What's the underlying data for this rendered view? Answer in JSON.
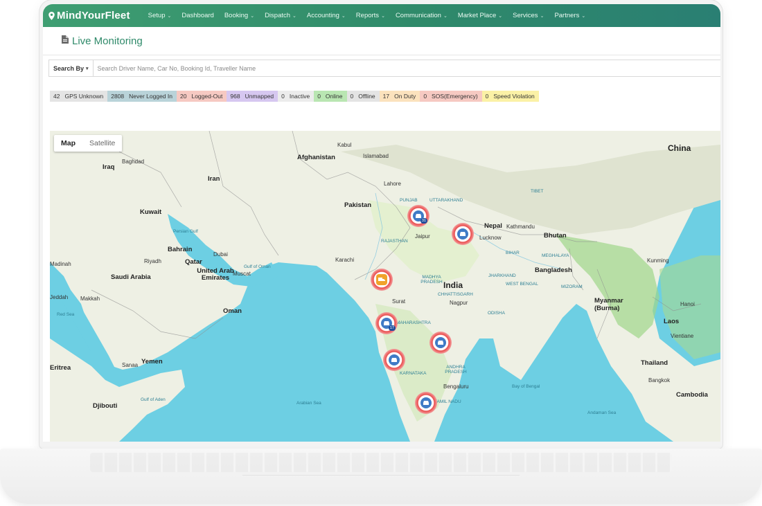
{
  "brand": {
    "name": "MindYourFleet"
  },
  "nav": [
    {
      "label": "Setup",
      "has_caret": true
    },
    {
      "label": "Dashboard",
      "has_caret": false
    },
    {
      "label": "Booking",
      "has_caret": true
    },
    {
      "label": "Dispatch",
      "has_caret": true
    },
    {
      "label": "Accounting",
      "has_caret": true
    },
    {
      "label": "Reports",
      "has_caret": true
    },
    {
      "label": "Communication",
      "has_caret": true
    },
    {
      "label": "Market Place",
      "has_caret": true
    },
    {
      "label": "Services",
      "has_caret": true
    },
    {
      "label": "Partners",
      "has_caret": true
    }
  ],
  "page": {
    "title": "Live Monitoring"
  },
  "search": {
    "by_label": "Search By",
    "placeholder": "Search Driver Name, Car No, Booking Id, Traveller Name"
  },
  "statuses": [
    {
      "count": "42",
      "label": "GPS Unknown",
      "color": "#e4e4e4"
    },
    {
      "count": "2808",
      "label": "Never Logged In",
      "color": "#b9d3d9"
    },
    {
      "count": "20",
      "label": "Logged-Out",
      "color": "#f6c9c2"
    },
    {
      "count": "968",
      "label": "Unmapped",
      "color": "#d6c7f0"
    },
    {
      "count": "0",
      "label": "Inactive",
      "color": "#ececec"
    },
    {
      "count": "0",
      "label": "Online",
      "color": "#b9e6b2"
    },
    {
      "count": "0",
      "label": "Offline",
      "color": "#e4e4e4"
    },
    {
      "count": "17",
      "label": "On Duty",
      "color": "#fbe2bd"
    },
    {
      "count": "0",
      "label": "SOS(Emergency)",
      "color": "#f6c9c2"
    },
    {
      "count": "0",
      "label": "Speed Violation",
      "color": "#fbf1a6"
    }
  ],
  "map": {
    "toggle": {
      "map": "Map",
      "satellite": "Satellite"
    },
    "labels": {
      "china": "China",
      "afghanistan": "Afghanistan",
      "iran": "Iran",
      "iraq": "Iraq",
      "baghdad": "Baghdad",
      "kuwait": "Kuwait",
      "bahrain": "Bahrain",
      "qatar": "Qatar",
      "riyadh": "Riyadh",
      "saudi": "Saudi Arabia",
      "uae": "United Arab Emirates",
      "dubai": "Dubai",
      "muscat": "Muscat",
      "oman": "Oman",
      "pakistan": "Pakistan",
      "lahore": "Lahore",
      "karachi": "Karachi",
      "islamabad": "Islamabad",
      "kabul": "Kabul",
      "nepal": "Nepal",
      "kathmandu": "Kathmandu",
      "bhutan": "Bhutan",
      "bangladesh": "Bangladesh",
      "india": "India",
      "jaipur": "Jaipur",
      "rajasthan": "RAJASTHAN",
      "madhya": "MADHYA PRADESH",
      "surat": "Surat",
      "nagpur": "Nagpur",
      "maharashtra": "MAHARASHTRA",
      "bengaluru": "Bengaluru",
      "karnataka": "KARNATAKA",
      "yemen": "Yemen",
      "sonaa": "Sanaa",
      "djibouti": "Djibouti",
      "eritrea": "Eritrea",
      "myanmar": "Myanmar (Burma)",
      "laos": "Laos",
      "thailand": "Thailand",
      "bangkok": "Bangkok",
      "cambodia": "Cambodia",
      "vientiane": "Vientiane",
      "hanoi": "Hanoi",
      "madinah": "Madinah",
      "jeddah": "Jeddah",
      "makkah": "Makkah",
      "arabian": "Arabian Sea",
      "bengal": "Bay of Bengal",
      "aden": "Gulf of Aden",
      "andaman": "Andaman Sea",
      "tibet": "TIBET",
      "kunming": "Kunming",
      "mizoram": "MIZORAM",
      "meghalaya": "MEGHALAYA",
      "jharkhand": "JHARKHAND",
      "westbengal": "WEST BENGAL",
      "odisha": "ODISHA",
      "andhra": "ANDHRA PRADESH",
      "tamil": "TAMIL NADU",
      "bihar": "BIHAR",
      "chhattisgarh": "CHHATTISGARH",
      "punjab": "PUNJAB",
      "uttarakhand": "UTTARAKHAND",
      "lucknow": "Lucknow",
      "persiangulf": "Persian Gulf",
      "gulfoman": "Gulf of Oman",
      "redsea": "Red Sea"
    },
    "markers": [
      {
        "badge": "31",
        "kind": "car"
      },
      {
        "badge": "",
        "kind": "car"
      },
      {
        "badge": "",
        "kind": "truck"
      },
      {
        "badge": "17",
        "kind": "car"
      },
      {
        "badge": "",
        "kind": "car"
      },
      {
        "badge": "",
        "kind": "car"
      },
      {
        "badge": "",
        "kind": "car"
      }
    ]
  },
  "colors": {
    "brand": "#2f8a6a",
    "water": "#6dcfe3",
    "land": "#eef0e4",
    "marker": "#e94c4c"
  }
}
